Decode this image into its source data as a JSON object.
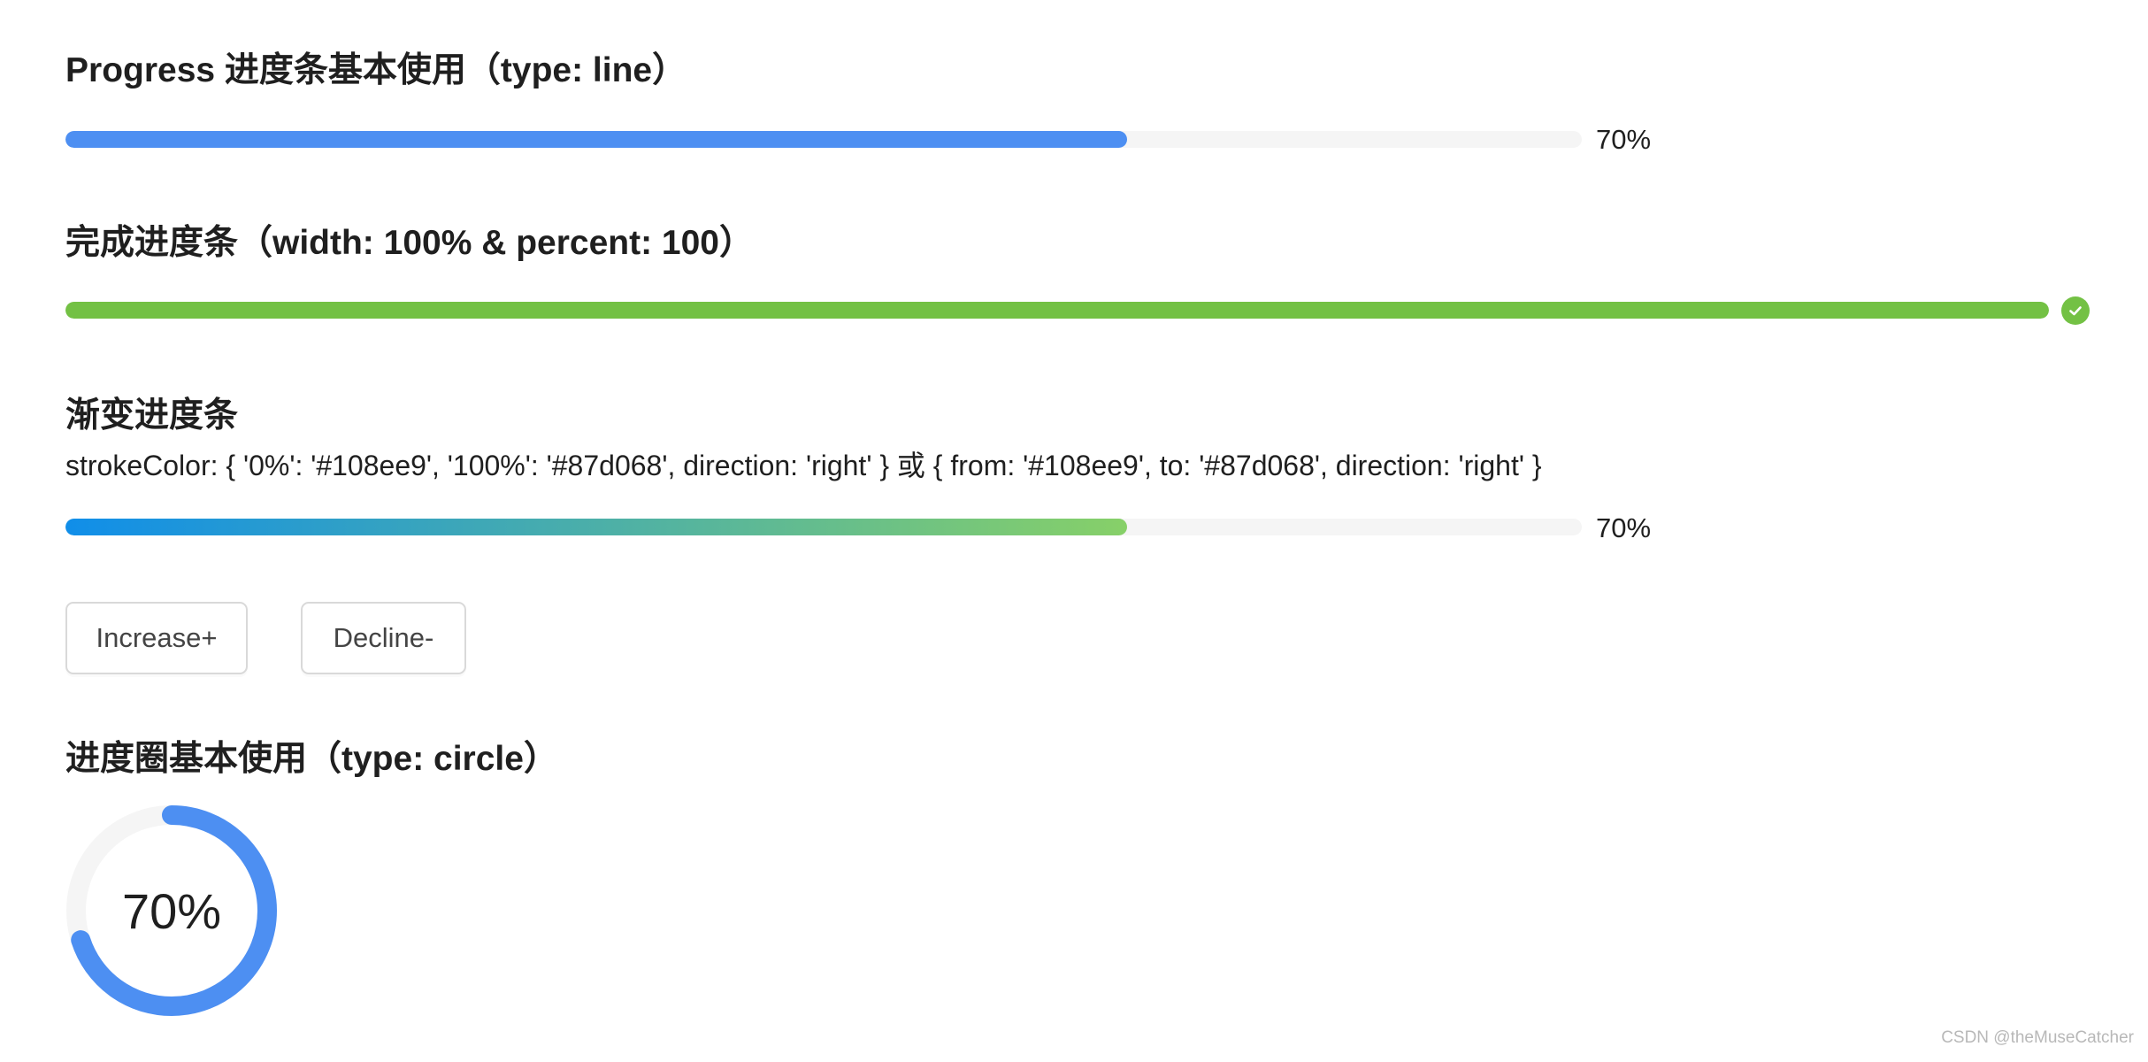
{
  "colors": {
    "primary": "#4d8ff2",
    "success": "#73c144",
    "track": "#f5f5f5",
    "gradient_from": "#108ee9",
    "gradient_to": "#87d068"
  },
  "section_line": {
    "title": "Progress 进度条基本使用（type: line）",
    "percent": 70,
    "label": "70%"
  },
  "section_complete": {
    "title": "完成进度条（width: 100% & percent: 100）",
    "percent": 100,
    "icon": "check-circle-icon"
  },
  "section_gradient": {
    "title": "渐变进度条",
    "code": "strokeColor: { '0%': '#108ee9', '100%': '#87d068', direction: 'right' } 或 { from: '#108ee9', to: '#87d068', direction: 'right' }",
    "percent": 70,
    "label": "70%"
  },
  "buttons": {
    "increase_label": "Increase+",
    "decline_label": "Decline-"
  },
  "section_circle": {
    "title": "进度圈基本使用（type: circle）",
    "percent": 70,
    "label": "70%"
  },
  "watermark": "CSDN @theMuseCatcher"
}
